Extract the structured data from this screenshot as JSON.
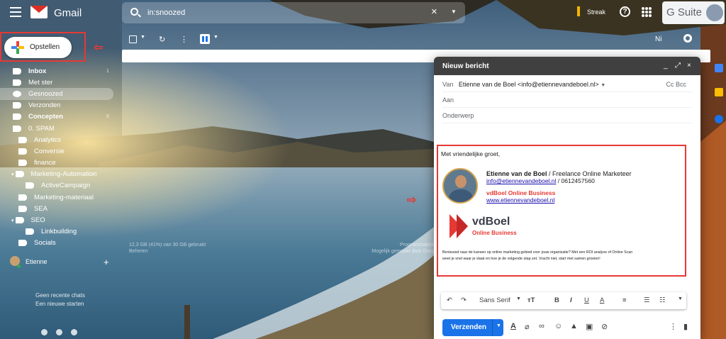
{
  "app": {
    "name": "Gmail"
  },
  "search": {
    "value": "in:snoozed"
  },
  "header": {
    "streak": "Streak",
    "gsuite": "G Suite"
  },
  "compose_button": {
    "label": "Opstellen"
  },
  "sidebar": {
    "items": [
      {
        "label": "Inbox",
        "bold": true,
        "count": "1"
      },
      {
        "label": "Met ster"
      },
      {
        "label": "Gesnoozed",
        "selected": true
      },
      {
        "label": "Verzonden"
      },
      {
        "label": "Concepten",
        "bold": true,
        "count": "8"
      },
      {
        "label": "0. SPAM"
      },
      {
        "label": "Analytics"
      },
      {
        "label": "Conversie"
      },
      {
        "label": "finance"
      },
      {
        "label": "Marketing-Automation"
      },
      {
        "label": "ActiveCampaign"
      },
      {
        "label": "Marketing-materiaal"
      },
      {
        "label": "SEA"
      },
      {
        "label": "SEO"
      },
      {
        "label": "Linkbuilding"
      },
      {
        "label": "Socials"
      }
    ]
  },
  "hangouts": {
    "user": "Etienne",
    "no_chats": "Geen recente chats",
    "start": "Een nieuwe starten"
  },
  "toolbar": {
    "lang": "Ni"
  },
  "footer": {
    "storage": "12,3 GB (41%) van 30 GB gebruikt",
    "manage": "Beheren",
    "program": "Programmabeleid",
    "powered": "Mogelijk gemaakt door Google"
  },
  "compose": {
    "title": "Nieuw bericht",
    "from_label": "Van",
    "from_value": "Etienne van de Boel <info@etiennevandeboel.nl>",
    "cc_bcc": "Cc Bcc",
    "to_label": "Aan",
    "subject_label": "Onderwerp",
    "greeting": "Met vriendelijke groet,",
    "sig_name": "Etienne van de Boel",
    "sig_role": " / Freelance Online Marketeer",
    "sig_email": "info@etiennevandeboel.nl",
    "sig_phone": " / 0612457560",
    "sig_company": "vdBoel Online Business",
    "sig_site": "www.etiennevandeboel.nl",
    "logo_name": "vdBoel",
    "logo_sub": "Online Business",
    "promo_1": "Benieuwd naar de kansen op online marketing gebied voor jouw organisatie? Met een ROI analyse of Online Scan",
    "promo_2": "weet je snel waar je staat en hoe je de volgende stap zet. Vracht niet, start met samen groeien!",
    "font": "Sans Serif",
    "send_label": "Verzenden"
  }
}
